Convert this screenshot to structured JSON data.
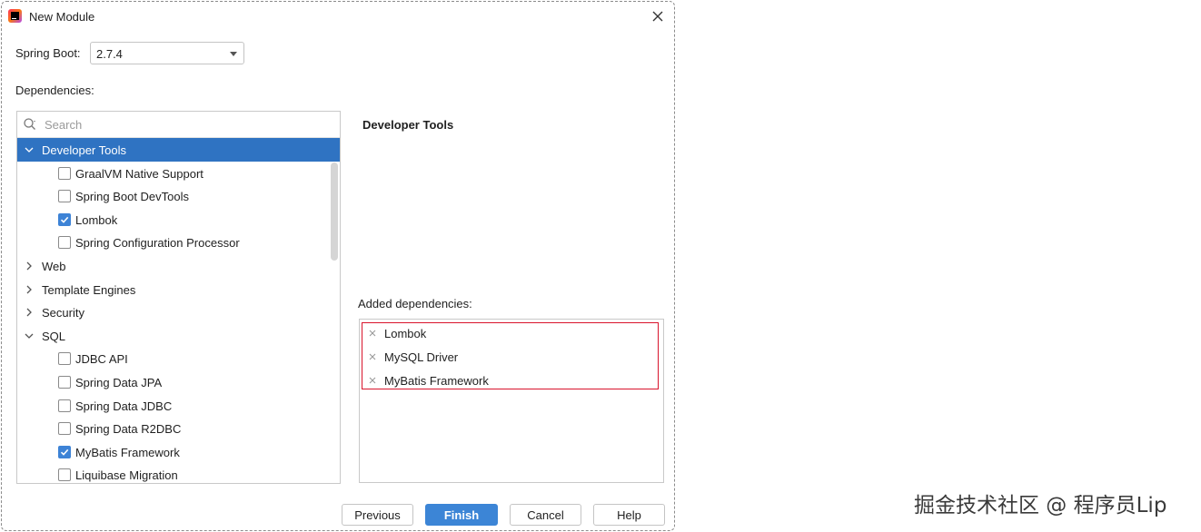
{
  "window": {
    "title": "New Module"
  },
  "spring_boot": {
    "label": "Spring Boot:",
    "selected": "2.7.4"
  },
  "dependencies_label": "Dependencies:",
  "search": {
    "placeholder": "Search",
    "value": ""
  },
  "tree": [
    {
      "kind": "group",
      "label": "Developer Tools",
      "expanded": true,
      "selected": true
    },
    {
      "kind": "item",
      "label": "GraalVM Native Support",
      "checked": false
    },
    {
      "kind": "item",
      "label": "Spring Boot DevTools",
      "checked": false
    },
    {
      "kind": "item",
      "label": "Lombok",
      "checked": true
    },
    {
      "kind": "item",
      "label": "Spring Configuration Processor",
      "checked": false
    },
    {
      "kind": "group",
      "label": "Web",
      "expanded": false
    },
    {
      "kind": "group",
      "label": "Template Engines",
      "expanded": false
    },
    {
      "kind": "group",
      "label": "Security",
      "expanded": false
    },
    {
      "kind": "group",
      "label": "SQL",
      "expanded": true
    },
    {
      "kind": "item",
      "label": "JDBC API",
      "checked": false
    },
    {
      "kind": "item",
      "label": "Spring Data JPA",
      "checked": false
    },
    {
      "kind": "item",
      "label": "Spring Data JDBC",
      "checked": false
    },
    {
      "kind": "item",
      "label": "Spring Data R2DBC",
      "checked": false
    },
    {
      "kind": "item",
      "label": "MyBatis Framework",
      "checked": true
    },
    {
      "kind": "item",
      "label": "Liquibase Migration",
      "checked": false
    }
  ],
  "detail": {
    "title": "Developer Tools"
  },
  "added": {
    "label": "Added dependencies:",
    "items": [
      "Lombok",
      "MySQL Driver",
      "MyBatis Framework"
    ]
  },
  "buttons": {
    "previous": "Previous",
    "finish": "Finish",
    "cancel": "Cancel",
    "help": "Help"
  },
  "watermark": "掘金技术社区 @ 程序员Lip",
  "colors": {
    "selection": "#2f73c2",
    "primary_button": "#3c85d6",
    "highlight_border": "#d9142c",
    "checkbox_on": "#3d83d6"
  }
}
